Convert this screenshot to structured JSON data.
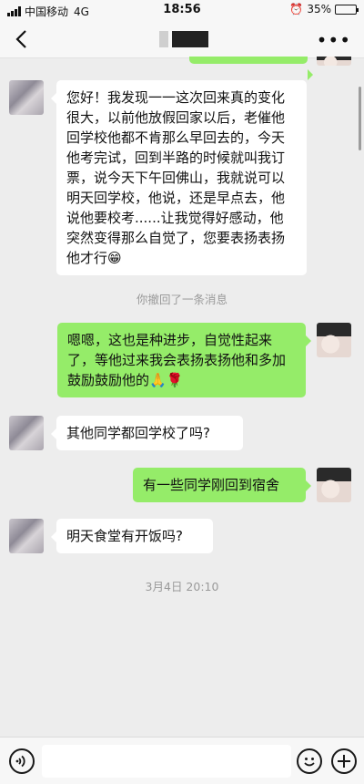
{
  "status_bar": {
    "carrier": "中国移动",
    "network": "4G",
    "time": "18:56",
    "battery": "35%",
    "battery_level": 0.35
  },
  "nav": {
    "back_icon": "chevron-left-icon",
    "more_icon": "ellipsis-icon"
  },
  "messages": [
    {
      "side": "in",
      "text": "您好！我发现一一这次回来真的变化很大，以前他放假回家以后，老催他回学校他都不肯那么早回去的，今天他考完试，回到半路的时候就叫我订票，说今天下午回佛山，我就说可以明天回学校，他说，还是早点去，他说他要校考......让我觉得好感动，他突然变得那么自觉了，您要表扬表扬他才行😁"
    },
    {
      "side": "system",
      "text": "你撤回了一条消息"
    },
    {
      "side": "out",
      "text": "嗯嗯，这也是种进步，自觉性起来了，等他过来我会表扬表扬他和多加鼓励鼓励他的🙏🌹"
    },
    {
      "side": "in",
      "text": "其他同学都回学校了吗?"
    },
    {
      "side": "out",
      "text": "有一些同学刚回到宿舍"
    },
    {
      "side": "in",
      "text": "明天食堂有开饭吗?"
    },
    {
      "side": "timestamp",
      "text": "3月4日 20:10"
    }
  ],
  "input_bar": {
    "voice_icon": "voice-icon",
    "emoji_icon": "emoji-icon",
    "plus_icon": "plus-icon",
    "colors": {
      "outgoing_bubble": "#95ec69",
      "incoming_bubble": "#ffffff",
      "background": "#ededed"
    }
  }
}
